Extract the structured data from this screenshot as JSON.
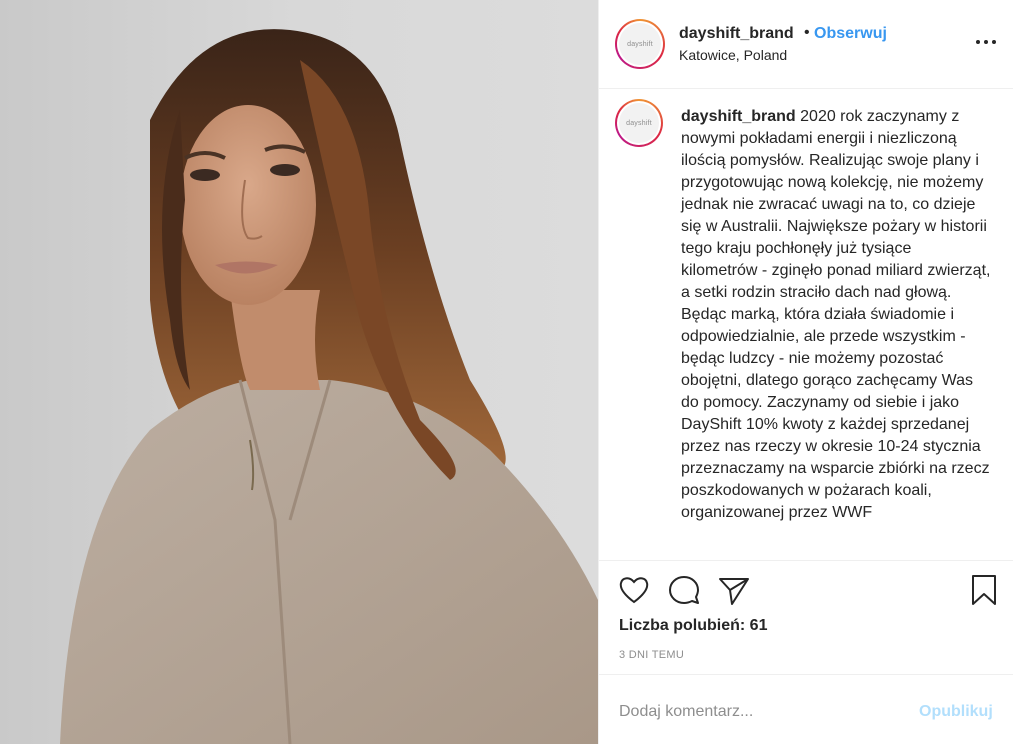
{
  "post": {
    "username": "dayshift_brand",
    "follow_label": "Obserwuj",
    "separator": "•",
    "location": "Katowice, Poland",
    "avatar_text": "dayshift",
    "caption": "2020 rok zaczynamy z nowymi pokładami energii i niezliczoną ilością pomysłów. Realizując swoje plany i przygotowując nową kolekcję, nie możemy jednak nie zwracać uwagi na to, co dzieje się w Australii. Największe pożary w historii tego kraju pochłonęły już tysiące kilometrów - zginęło ponad miliard zwierząt, a setki rodzin straciło dach nad głową. Będąc marką, która działa świadomie i odpowiedzialnie, ale przede wszystkim - będąc ludzcy - nie możemy pozostać obojętni, dlatego gorąco zachęcamy Was do pomocy. Zaczynamy od siebie i jako DayShift 10% kwoty z każdej sprzedanej przez nas rzeczy w okresie 10-24 stycznia przeznaczamy na wsparcie zbiórki na rzecz poszkodowanych w pożarach koali, organizowanej przez WWF",
    "likes_label": "Liczba polubień: 61",
    "time_ago": "3 DNI TEMU"
  },
  "comment": {
    "placeholder": "Dodaj komentarz...",
    "publish_label": "Opublikuj"
  },
  "icons": {
    "more": "more-horizontal-icon",
    "like": "heart-icon",
    "comment": "comment-bubble-icon",
    "share": "paper-plane-icon",
    "save": "bookmark-icon"
  },
  "colors": {
    "link_blue": "#3897f0",
    "publish_disabled": "#b2dffc",
    "muted": "#8e8e8e"
  }
}
